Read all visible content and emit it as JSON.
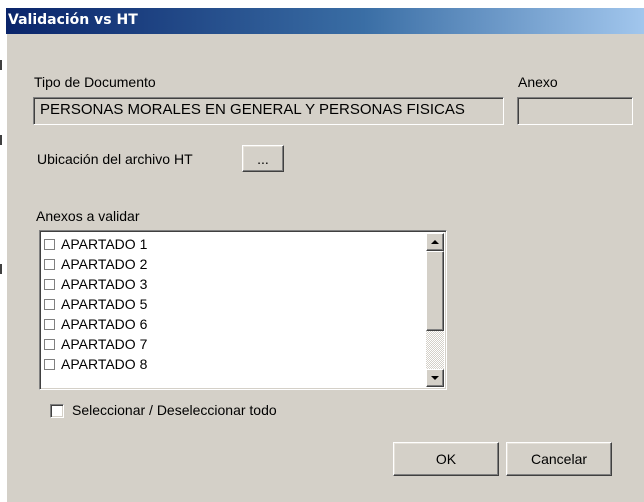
{
  "window": {
    "title": "Validación vs HT"
  },
  "tipo_documento": {
    "label": "Tipo de Documento",
    "value": "PERSONAS MORALES EN GENERAL Y PERSONAS FISICAS"
  },
  "anexo": {
    "label": "Anexo",
    "value": ""
  },
  "ubicacion": {
    "label": "Ubicación del archivo HT",
    "browse_label": "..."
  },
  "anexos_validar": {
    "label": "Anexos a validar",
    "items": [
      {
        "label": "APARTADO 1",
        "checked": false
      },
      {
        "label": "APARTADO 2",
        "checked": false
      },
      {
        "label": "APARTADO 3",
        "checked": false
      },
      {
        "label": "APARTADO 5",
        "checked": false
      },
      {
        "label": "APARTADO 6",
        "checked": false
      },
      {
        "label": "APARTADO 7",
        "checked": false
      },
      {
        "label": "APARTADO 8",
        "checked": false
      }
    ]
  },
  "select_all": {
    "label": "Seleccionar / Deseleccionar todo",
    "checked": false
  },
  "buttons": {
    "ok_label": "OK",
    "cancel_label": "Cancelar"
  },
  "colors": {
    "face": "#d4d0c8",
    "title_start": "#0a246a",
    "title_end": "#a6caf0",
    "title_text": "#ffffff"
  },
  "icons": {
    "scroll_up": "scroll-up-arrow-icon",
    "scroll_down": "scroll-down-arrow-icon"
  }
}
